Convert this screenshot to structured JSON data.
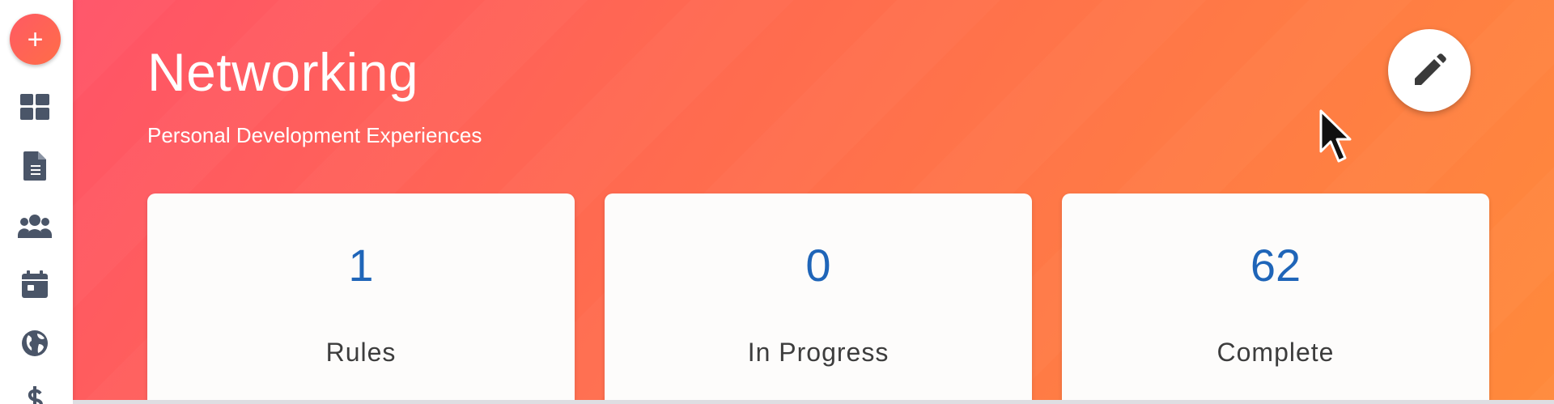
{
  "sidebar": {
    "add_label": "+",
    "items": [
      {
        "icon": "dashboard-icon"
      },
      {
        "icon": "document-icon"
      },
      {
        "icon": "users-icon"
      },
      {
        "icon": "calendar-icon"
      },
      {
        "icon": "globe-icon"
      },
      {
        "icon": "dollar-icon"
      }
    ]
  },
  "header": {
    "title": "Networking",
    "subtitle": "Personal Development Experiences"
  },
  "actions": {
    "edit_icon": "pencil-icon"
  },
  "stats": [
    {
      "count": "1",
      "label": "Rules"
    },
    {
      "count": "0",
      "label": "In Progress"
    },
    {
      "count": "62",
      "label": "Complete"
    }
  ],
  "colors": {
    "accent_start": "#ff5368",
    "accent_end": "#ff8a3b",
    "count_blue": "#1f65b8",
    "icon_slate": "#4a5568"
  }
}
